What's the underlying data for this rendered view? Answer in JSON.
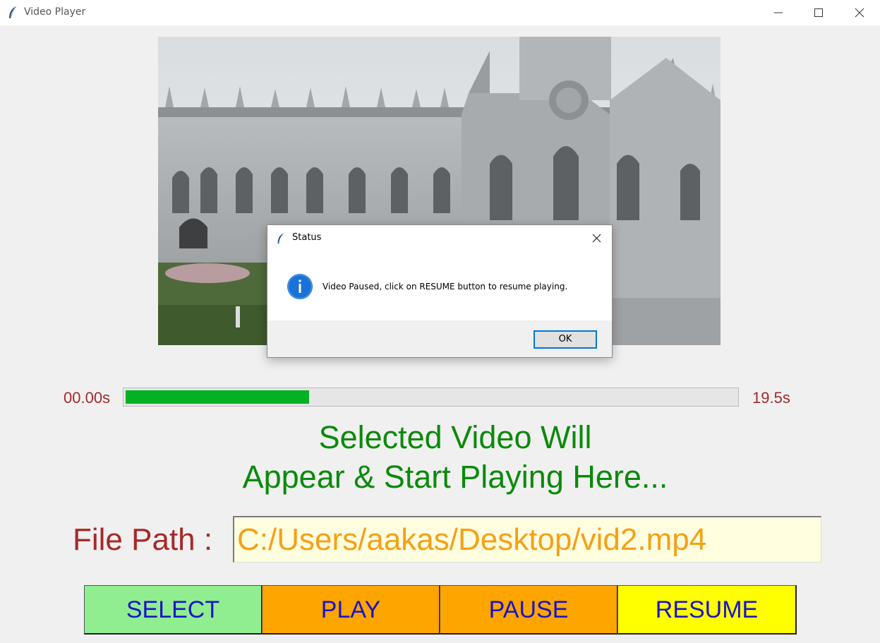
{
  "window": {
    "title": "Video Player",
    "controls": [
      "minimize-icon",
      "maximize-icon",
      "close-icon"
    ]
  },
  "player": {
    "time_start": "00.00s",
    "time_end": "19.5s",
    "progress_fraction": 0.3,
    "progress_color": "#06b025",
    "message_line1": "Selected Video Will",
    "message_line2": "Appear & Start Playing Here...",
    "message_color": "#0b8a0b"
  },
  "file": {
    "label": "File Path :",
    "path_value": "C:/Users/aakas/Desktop/vid2.mp4",
    "path_color": "#f5a017",
    "label_color": "#a52a2a"
  },
  "buttons": [
    {
      "label": "SELECT",
      "color": "#90ee90"
    },
    {
      "label": "PLAY",
      "color": "#ffa500"
    },
    {
      "label": "PAUSE",
      "color": "#ffa500"
    },
    {
      "label": "RESUME",
      "color": "#ffff00"
    }
  ],
  "dialog": {
    "title": "Status",
    "icon": "info-icon",
    "message": "Video Paused, click on RESUME button to resume playing.",
    "ok_label": "OK"
  }
}
